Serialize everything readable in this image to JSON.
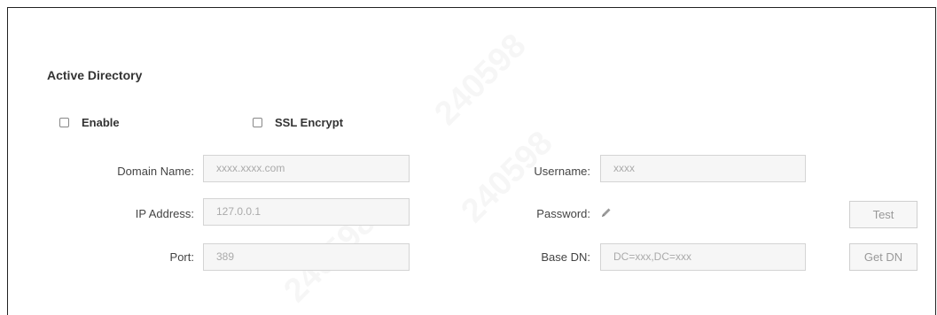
{
  "section": {
    "title": "Active Directory"
  },
  "options": {
    "enable_label": "Enable",
    "ssl_label": "SSL Encrypt"
  },
  "fields": {
    "domain_name": {
      "label": "Domain Name:",
      "value": "xxxx.xxxx.com"
    },
    "ip_address": {
      "label": "IP Address:",
      "value": "127.0.0.1"
    },
    "port": {
      "label": "Port:",
      "value": "389"
    },
    "username": {
      "label": "Username:",
      "value": "xxxx"
    },
    "password": {
      "label": "Password:",
      "icon": "pencil-icon"
    },
    "base_dn": {
      "label": "Base DN:",
      "value": "DC=xxx,DC=xxx"
    }
  },
  "buttons": {
    "test_label": "Test",
    "get_dn_label": "Get DN"
  },
  "watermark": "240598",
  "colors": {
    "input_bg": "#f6f6f6",
    "input_border": "#d4d4d4",
    "text": "#333333"
  }
}
